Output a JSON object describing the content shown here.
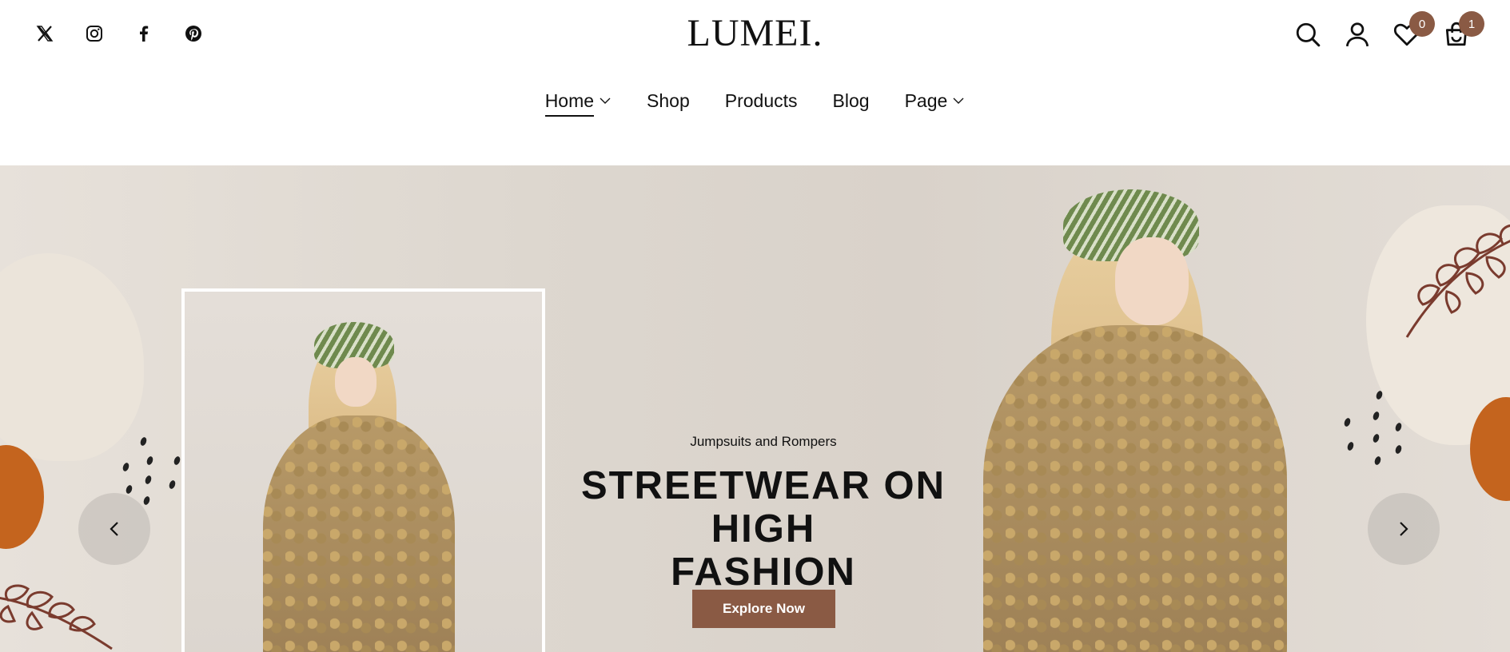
{
  "header": {
    "logo": "LUMEI.",
    "socials": [
      {
        "icon": "x-icon"
      },
      {
        "icon": "instagram-icon"
      },
      {
        "icon": "facebook-icon"
      },
      {
        "icon": "pinterest-icon"
      }
    ],
    "wishlist_count": "0",
    "cart_count": "1"
  },
  "nav": {
    "items": [
      {
        "label": "Home",
        "has_dropdown": true,
        "active": true
      },
      {
        "label": "Shop",
        "has_dropdown": false
      },
      {
        "label": "Products",
        "has_dropdown": false
      },
      {
        "label": "Blog",
        "has_dropdown": false
      },
      {
        "label": "Page",
        "has_dropdown": true
      }
    ]
  },
  "hero": {
    "subtitle": "Jumpsuits and Rompers",
    "title_line1": "STREETWEAR ON HIGH",
    "title_line2": "FASHION",
    "cta_label": "Explore Now"
  },
  "colors": {
    "accent": "#8a5a44",
    "orange": "#c4641e",
    "leaf": "#7a3b2e"
  }
}
